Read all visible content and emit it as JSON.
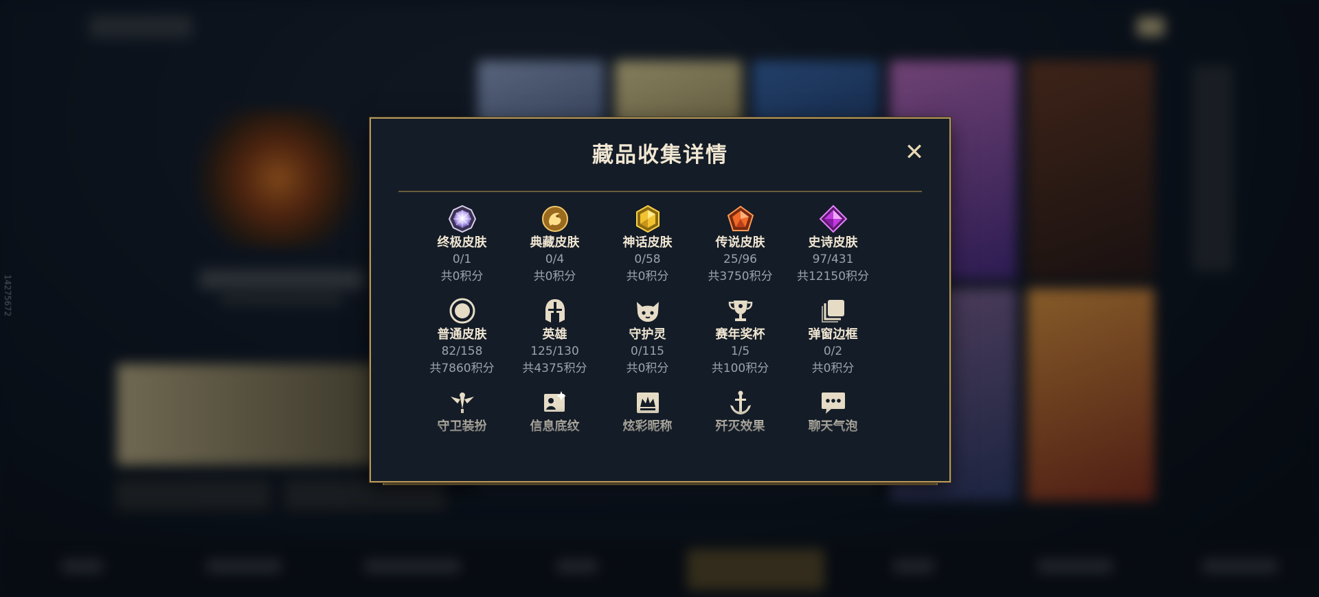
{
  "background": {
    "side_id": "14275672"
  },
  "dialog": {
    "title": "藏品收集详情",
    "close_symbol": "✕",
    "items": [
      {
        "icon": "ultimate-skin-icon",
        "name": "终极皮肤",
        "count": "0/1",
        "points": "共0积分"
      },
      {
        "icon": "prestige-skin-icon",
        "name": "典藏皮肤",
        "count": "0/4",
        "points": "共0积分"
      },
      {
        "icon": "mythic-skin-icon",
        "name": "神话皮肤",
        "count": "0/58",
        "points": "共0积分"
      },
      {
        "icon": "legendary-skin-icon",
        "name": "传说皮肤",
        "count": "25/96",
        "points": "共3750积分"
      },
      {
        "icon": "epic-skin-icon",
        "name": "史诗皮肤",
        "count": "97/431",
        "points": "共12150积分"
      },
      {
        "icon": "regular-skin-icon",
        "name": "普通皮肤",
        "count": "82/158",
        "points": "共7860积分"
      },
      {
        "icon": "champion-icon",
        "name": "英雄",
        "count": "125/130",
        "points": "共4375积分"
      },
      {
        "icon": "guardian-icon",
        "name": "守护灵",
        "count": "0/115",
        "points": "共0积分"
      },
      {
        "icon": "trophy-icon",
        "name": "赛年奖杯",
        "count": "1/5",
        "points": "共100积分"
      },
      {
        "icon": "frame-icon",
        "name": "弹窗边框",
        "count": "0/2",
        "points": "共0积分"
      },
      {
        "icon": "ward-skin-icon",
        "name": "守卫装扮",
        "count": "",
        "points": ""
      },
      {
        "icon": "banner-icon",
        "name": "信息底纹",
        "count": "",
        "points": ""
      },
      {
        "icon": "nickname-icon",
        "name": "炫彩昵称",
        "count": "",
        "points": ""
      },
      {
        "icon": "finisher-icon",
        "name": "歼灭效果",
        "count": "",
        "points": ""
      },
      {
        "icon": "chat-bubble-icon",
        "name": "聊天气泡",
        "count": "",
        "points": ""
      }
    ]
  },
  "colors": {
    "gold_border": "#b8995a",
    "dialog_bg": "#141c27",
    "title": "#f0e6d2",
    "muted": "#9aa3ae"
  }
}
